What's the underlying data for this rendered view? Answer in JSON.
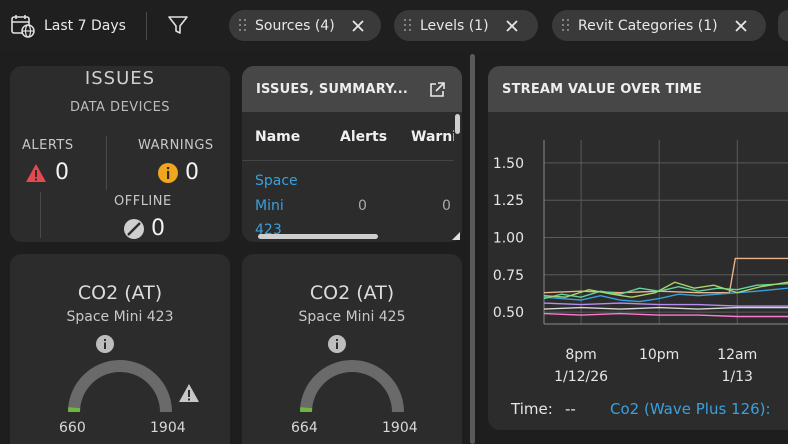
{
  "toolbar": {
    "date_range": "Last 7 Days",
    "filters": [
      {
        "label": "Sources (4)"
      },
      {
        "label": "Levels (1)"
      },
      {
        "label": "Revit Categories (1)"
      }
    ]
  },
  "issues": {
    "title": "ISSUES",
    "subtitle": "DATA DEVICES",
    "alerts_label": "ALERTS",
    "alerts_value": "0",
    "warnings_label": "WARNINGS",
    "warnings_value": "0",
    "offline_label": "OFFLINE",
    "offline_value": "0",
    "colors": {
      "alert": "#e5484d",
      "warning": "#f0a61e"
    }
  },
  "summary": {
    "title": "ISSUES, SUMMARY...",
    "columns": [
      "Name",
      "Alerts",
      "Warni"
    ],
    "rows": [
      {
        "name_line1": "Space",
        "name_line2": "Mini",
        "name_line3": "423",
        "alerts": "0",
        "warnings": "0"
      }
    ]
  },
  "gauges": [
    {
      "title": "CO2 (AT)",
      "subtitle": "Space Mini 423",
      "min": "660",
      "max": "1904",
      "level": 0.03
    },
    {
      "title": "CO2 (AT)",
      "subtitle": "Space Mini 425",
      "min": "664",
      "max": "1904",
      "level": 0.03
    }
  ],
  "chart_title": "STREAM VALUE OVER TIME",
  "chart_data": {
    "type": "line",
    "yticks": [
      "1.50",
      "1.25",
      "1.00",
      "0.75",
      "0.50"
    ],
    "ylim": [
      0.42,
      1.6
    ],
    "xticks": [
      {
        "line1": "8pm",
        "line2": "1/12/26",
        "t": 0
      },
      {
        "line1": "10pm",
        "line2": "",
        "t": 2
      },
      {
        "line1": "12am",
        "line2": "1/13",
        "t": 4
      }
    ],
    "xlim": [
      -0.95,
      5.3
    ],
    "series": [
      {
        "color": "#e8b48a",
        "points": [
          [
            -0.95,
            0.63
          ],
          [
            0,
            0.64
          ],
          [
            1,
            0.63
          ],
          [
            2,
            0.64
          ],
          [
            3,
            0.63
          ],
          [
            3.8,
            0.63
          ],
          [
            3.95,
            0.86
          ],
          [
            5.3,
            0.86
          ]
        ]
      },
      {
        "color": "#3aa0dd",
        "points": [
          [
            -0.95,
            0.6
          ],
          [
            0,
            0.58
          ],
          [
            0.5,
            0.61
          ],
          [
            1,
            0.58
          ],
          [
            1.5,
            0.57
          ],
          [
            2,
            0.59
          ],
          [
            2.5,
            0.62
          ],
          [
            3,
            0.61
          ],
          [
            3.5,
            0.62
          ],
          [
            4,
            0.63
          ],
          [
            4.5,
            0.64
          ],
          [
            5.3,
            0.66
          ]
        ]
      },
      {
        "color": "#5fd3a0",
        "points": [
          [
            -0.95,
            0.59
          ],
          [
            -0.5,
            0.62
          ],
          [
            0,
            0.6
          ],
          [
            0.5,
            0.64
          ],
          [
            1,
            0.62
          ],
          [
            1.5,
            0.66
          ],
          [
            2,
            0.64
          ],
          [
            2.5,
            0.67
          ],
          [
            3,
            0.64
          ],
          [
            3.5,
            0.66
          ],
          [
            4,
            0.65
          ],
          [
            4.5,
            0.68
          ],
          [
            5.3,
            0.69
          ]
        ]
      },
      {
        "color": "#a9d46b",
        "points": [
          [
            -0.95,
            0.61
          ],
          [
            -0.4,
            0.6
          ],
          [
            0.2,
            0.65
          ],
          [
            0.8,
            0.62
          ],
          [
            1.3,
            0.6
          ],
          [
            1.9,
            0.63
          ],
          [
            2.4,
            0.7
          ],
          [
            2.9,
            0.66
          ],
          [
            3.4,
            0.68
          ],
          [
            4,
            0.63
          ],
          [
            4.6,
            0.67
          ],
          [
            5.3,
            0.7
          ]
        ]
      },
      {
        "color": "#ff7ad1",
        "points": [
          [
            -0.95,
            0.49
          ],
          [
            0,
            0.48
          ],
          [
            1,
            0.49
          ],
          [
            2,
            0.48
          ],
          [
            3,
            0.48
          ],
          [
            4,
            0.47
          ],
          [
            5,
            0.47
          ],
          [
            5.3,
            0.47
          ]
        ]
      },
      {
        "color": "#b58cf0",
        "points": [
          [
            -0.95,
            0.56
          ],
          [
            0,
            0.55
          ],
          [
            1,
            0.56
          ],
          [
            2,
            0.55
          ],
          [
            3,
            0.55
          ],
          [
            4,
            0.54
          ],
          [
            5.3,
            0.54
          ]
        ]
      },
      {
        "color": "#d6d6d6",
        "points": [
          [
            -0.95,
            0.52
          ],
          [
            0,
            0.53
          ],
          [
            1,
            0.52
          ],
          [
            2,
            0.53
          ],
          [
            3,
            0.52
          ],
          [
            4,
            0.53
          ],
          [
            5.3,
            0.53
          ]
        ]
      }
    ],
    "grid": true
  },
  "chart_footer": {
    "time_label": "Time:",
    "time_value": "--",
    "series_label": "Co2 (Wave Plus 126):"
  }
}
